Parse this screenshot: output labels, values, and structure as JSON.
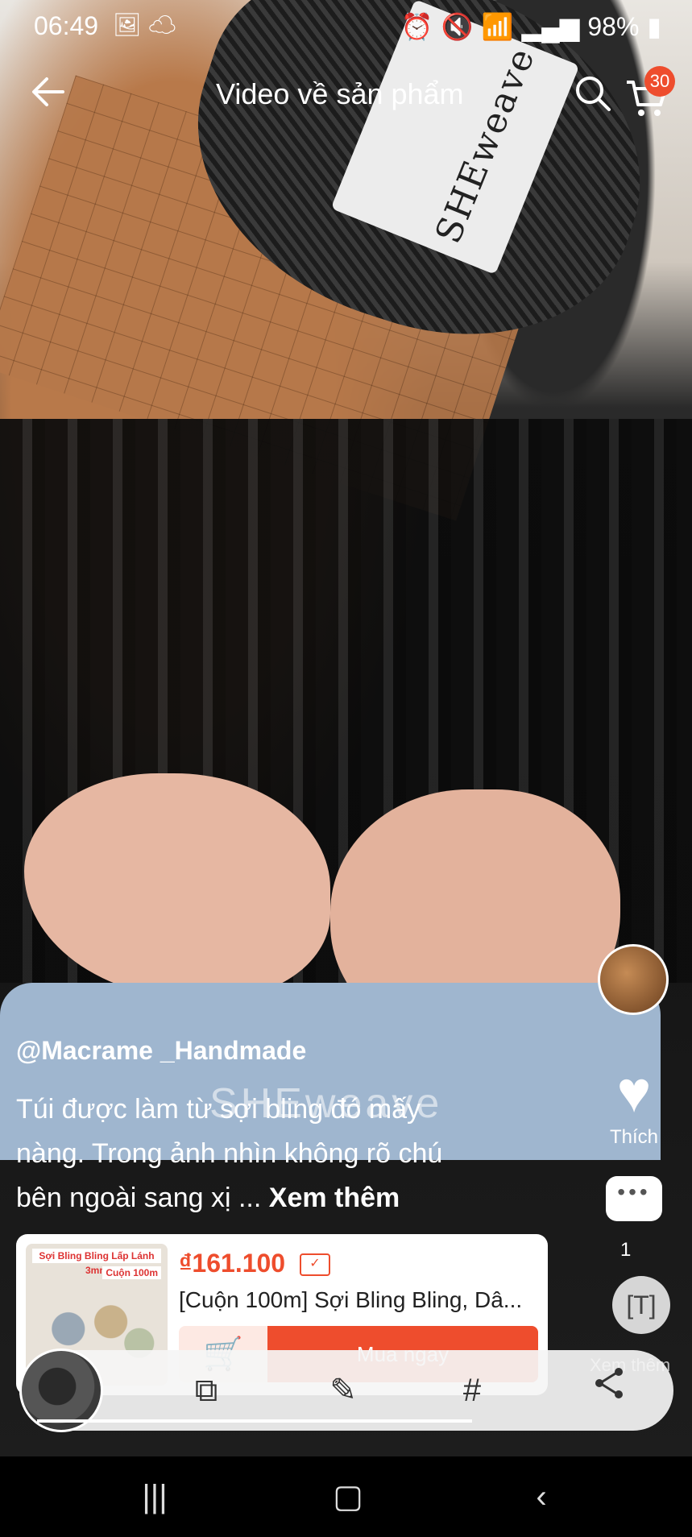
{
  "status": {
    "time": "06:49",
    "battery": "98%"
  },
  "topbar": {
    "title": "Video về sản phẩm",
    "cart_count": "30"
  },
  "video": {
    "watermark": "SHEweave",
    "yarn_label": "SHEweave",
    "username": "@Macrame _Handmade",
    "caption_line1": "Túi được làm từ sợi bling đó mấy",
    "caption_line2": "nàng. Trong ảnh nhìn không rõ chú",
    "caption_line3": " bên ngoài sang xị ...",
    "caption_more": "Xem thêm"
  },
  "side_actions": {
    "like_label": "Thích",
    "comment_count": "1",
    "more_label": "Xem thêm"
  },
  "product": {
    "price": "₫161.100",
    "name": "[Cuộn 100m] Sợi Bling Bling, Dâ...",
    "thumb_banner": "Sợi Bling Bling Lấp Lánh 3mm",
    "thumb_tag": "Cuộn 100m",
    "buy_label": "Mua ngay"
  },
  "icons": {
    "back": "back-arrow-icon",
    "search": "search-icon",
    "cart": "cart-icon",
    "like": "heart-icon",
    "comment": "comment-icon",
    "ocr": "text-scan-icon",
    "share": "share-icon"
  },
  "colors": {
    "accent": "#ee4d2d"
  }
}
